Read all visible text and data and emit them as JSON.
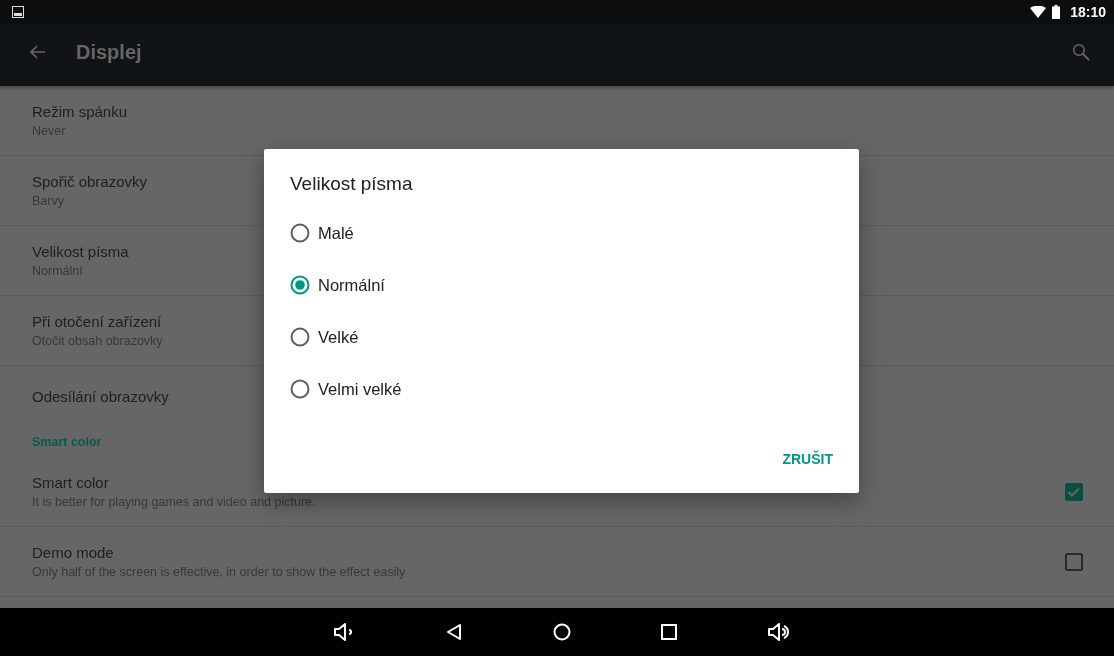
{
  "status_bar": {
    "time": "18:10"
  },
  "toolbar": {
    "title": "Displej"
  },
  "settings": [
    {
      "kind": "item",
      "title": "Režim spánku",
      "subtitle": "Never"
    },
    {
      "kind": "item",
      "title": "Spořič obrazovky",
      "subtitle": "Barvy"
    },
    {
      "kind": "item",
      "title": "Velikost písma",
      "subtitle": "Normální"
    },
    {
      "kind": "item",
      "title": "Při otočení zařízení",
      "subtitle": "Otočit obsah obrazovky"
    },
    {
      "kind": "item",
      "title": "Odesílání obrazovky"
    },
    {
      "kind": "header",
      "title": "Smart color"
    },
    {
      "kind": "checkbox",
      "title": "Smart color",
      "subtitle": "It is better for playing games and video and picture.",
      "checked": true
    },
    {
      "kind": "checkbox",
      "title": "Demo mode",
      "subtitle": "Only half of the screen is effective, in order to show the effect easily",
      "checked": false
    }
  ],
  "dialog": {
    "title": "Velikost písma",
    "options": [
      {
        "label": "Malé",
        "selected": false
      },
      {
        "label": "Normální",
        "selected": true
      },
      {
        "label": "Velké",
        "selected": false
      },
      {
        "label": "Velmi velké",
        "selected": false
      }
    ],
    "buttons": [
      "ZRUŠIT"
    ]
  }
}
